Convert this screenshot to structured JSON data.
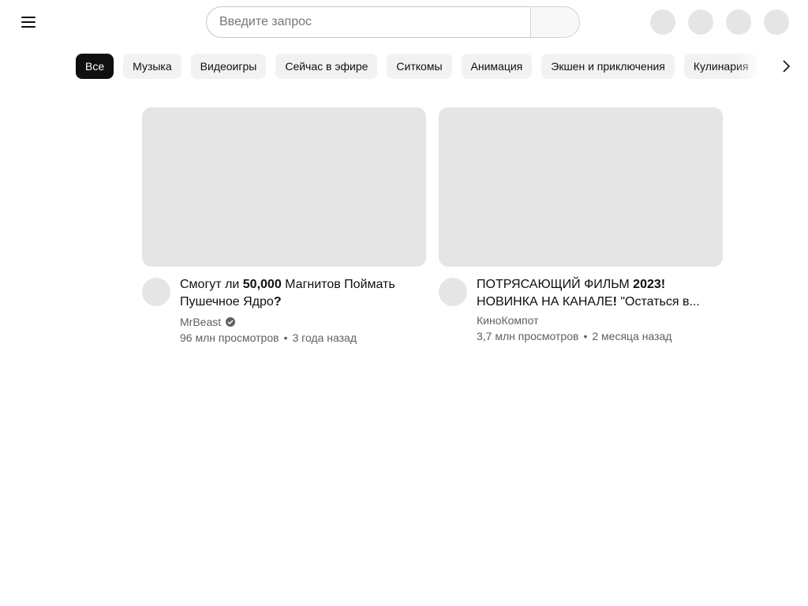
{
  "search": {
    "placeholder": "Введите запрос"
  },
  "header": {
    "menu_icon": "hamburger-menu-icon",
    "right_buttons": [
      "create-icon",
      "notifications-icon",
      "apps-icon",
      "account-avatar"
    ]
  },
  "chips": [
    "Все",
    "Музыка",
    "Видеоигры",
    "Сейчас в эфире",
    "Ситкомы",
    "Анимация",
    "Экшен и приключения",
    "Кулинария"
  ],
  "chips_active_index": 0,
  "videos": [
    {
      "title_parts": [
        "Смогут ли ",
        "50,000",
        " Магнитов Поймать Пушечное Ядро",
        "?"
      ],
      "channel": "MrBeast",
      "verified": true,
      "views": "96 млн просмотров",
      "age": "3 года назад"
    },
    {
      "title_parts": [
        "ПОТРЯСАЮЩИЙ ФИЛЬМ ",
        "2023!",
        " НОВИНКА НА КАНАЛЕ",
        "!",
        " \"Остаться в..."
      ],
      "channel": "КиноКомпот",
      "verified": false,
      "views": "3,7 млн просмотров",
      "age": "2 месяца назад"
    }
  ],
  "separator": "•",
  "colors": {
    "text": "#0f0f0f",
    "secondary": "#606060",
    "placeholder_bg": "#e5e5e5",
    "chip_bg": "#f2f2f2",
    "chip_active_bg": "#0f0f0f"
  }
}
